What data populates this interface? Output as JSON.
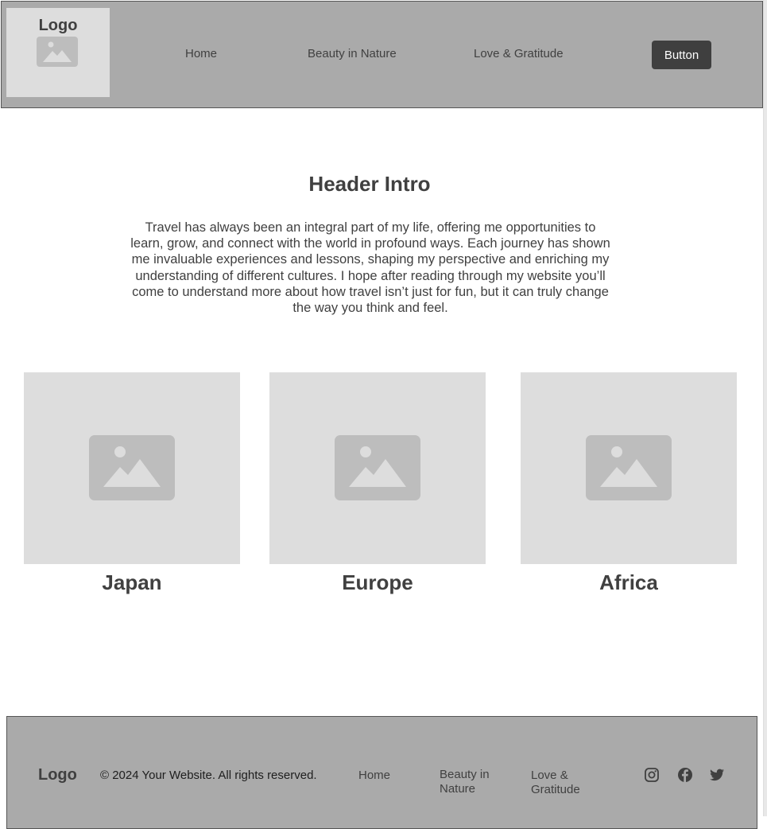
{
  "header": {
    "logo": "Logo",
    "nav": [
      "Home",
      "Beauty in Nature",
      "Love & Gratitude"
    ],
    "button_label": "Button"
  },
  "intro": {
    "title": "Header Intro",
    "body": "Travel has always been an integral part of my life, offering me opportunities to learn, grow, and connect with the world in profound ways. Each journey has shown me invaluable experiences and lessons, shaping my perspective and enriching my understanding of different cultures. I hope after reading through my website you’ll come to understand more about how travel isn’t just for fun, but it can truly change the way you think and feel."
  },
  "cards": [
    {
      "title": "Japan",
      "icon": "image-placeholder-icon"
    },
    {
      "title": "Europe",
      "icon": "image-placeholder-icon"
    },
    {
      "title": "Africa",
      "icon": "image-placeholder-icon"
    }
  ],
  "footer": {
    "logo": "Logo",
    "copyright": "© 2024 Your Website. All rights reserved.",
    "links": [
      "Home",
      "Beauty in Nature",
      "Love & Gratitude"
    ],
    "social_icons": [
      "instagram-icon",
      "facebook-icon",
      "twitter-icon"
    ]
  },
  "colors": {
    "header_bg": "#aaaaaa",
    "placeholder_bg": "#dddddd",
    "placeholder_icon": "#bdbdbd",
    "button_bg": "#3f3f3f",
    "text": "#404040"
  }
}
